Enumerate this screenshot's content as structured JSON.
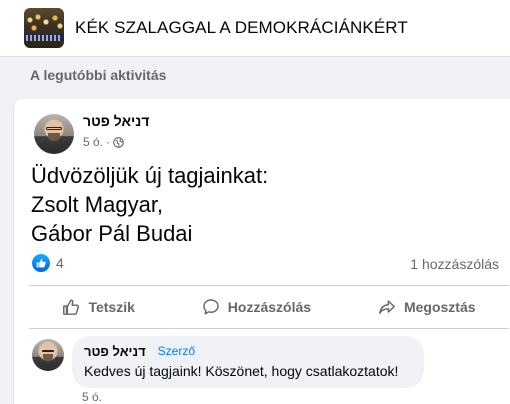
{
  "group": {
    "name": "KÉK SZALAGGAL A DEMOKRÁCIÁNKÉRT"
  },
  "section": {
    "title": "A legutóbbi aktivitás"
  },
  "post": {
    "author": "דניאל פטר",
    "time": "5 ó.",
    "privacy_icon": "globe-icon",
    "text_lines": [
      "Üdvözöljük új tagjainkat:",
      "Zsolt Magyar,",
      "Gábor Pál Budai"
    ],
    "reactions": {
      "icon": "like-icon",
      "count": "4"
    },
    "comments_count": "1 hozzászólás",
    "actions": {
      "like": "Tetszik",
      "comment": "Hozzászólás",
      "share": "Megosztás"
    }
  },
  "comment": {
    "author": "דניאל פטר",
    "badge": "Szerző",
    "text": "Kedves új tagjaink! Köszönet, hogy csatlakoztatok!",
    "time": "5 ó."
  },
  "colors": {
    "background": "#f0f2f5",
    "card": "#ffffff",
    "secondary_text": "#65676b",
    "accent_blue": "#1b74e4"
  }
}
